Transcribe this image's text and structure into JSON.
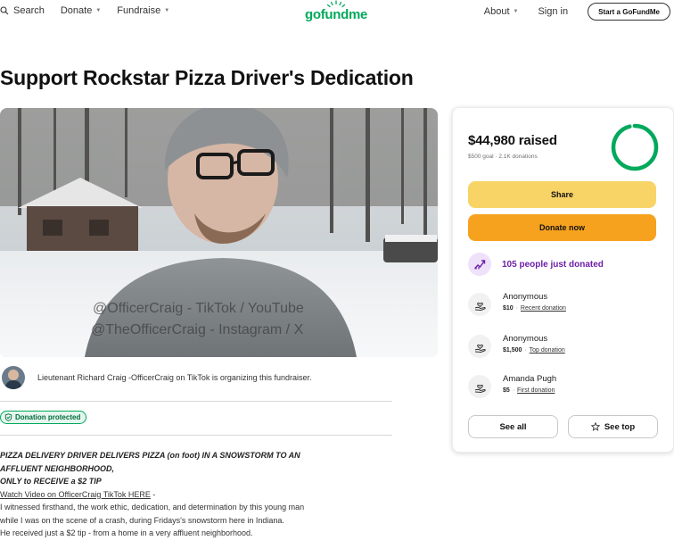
{
  "nav": {
    "search_label": "Search",
    "donate_label": "Donate",
    "fundraise_label": "Fundraise",
    "logo_text": "gofundme",
    "about_label": "About",
    "signin_label": "Sign in",
    "start_label": "Start a GoFundMe"
  },
  "page": {
    "title": "Support Rockstar Pizza Driver's Dedication"
  },
  "hero": {
    "overlay_line1": "@OfficerCraig - TikTok / YouTube",
    "overlay_line2": "@TheOfficerCraig - Instagram / X"
  },
  "organizer": {
    "text": "Lieutenant Richard Craig -OfficerCraig on TikTok is organizing this fundraiser."
  },
  "badge": {
    "protected_label": "Donation protected"
  },
  "story": {
    "headline1": "PIZZA DELIVERY DRIVER DELIVERS PIZZA (on foot) IN A SNOWSTORM TO AN",
    "headline2": "AFFLUENT NEIGHBORHOOD,",
    "headline3": "ONLY to RECEIVE a $2 TIP",
    "video_link": "Watch Video on OfficerCraig TikTok HERE",
    "video_suffix": " -",
    "para1": "I witnessed firsthand, the work ethic, dedication, and determination by this young man",
    "para2": "while I was on the scene of a crash, during Fridays's snowstorm here in Indiana.",
    "para3": "He received just a $2 tip - from a home in a very affluent neighborhood."
  },
  "card": {
    "raised": "$44,980 raised",
    "goal": "$500 goal",
    "donations": "2.1K donations",
    "progress_fraction": 0.96,
    "share_label": "Share",
    "donate_label": "Donate now",
    "recent_text": "105 people just donated",
    "see_all_label": "See all",
    "see_top_label": "See top",
    "donors": [
      {
        "name": "Anonymous",
        "amount": "$10",
        "tag": "Recent donation"
      },
      {
        "name": "Anonymous",
        "amount": "$1,500",
        "tag": "Top donation"
      },
      {
        "name": "Amanda Pugh",
        "amount": "$5",
        "tag": "First donation"
      }
    ]
  },
  "colors": {
    "brand_green": "#02a95c",
    "share_yellow": "#f8d467",
    "donate_orange": "#f6a21f",
    "purple": "#6d1fa8"
  },
  "icons": [
    "search-icon",
    "chevron-down-icon",
    "shield-check-icon",
    "trending-icon",
    "hand-heart-icon",
    "star-icon"
  ]
}
